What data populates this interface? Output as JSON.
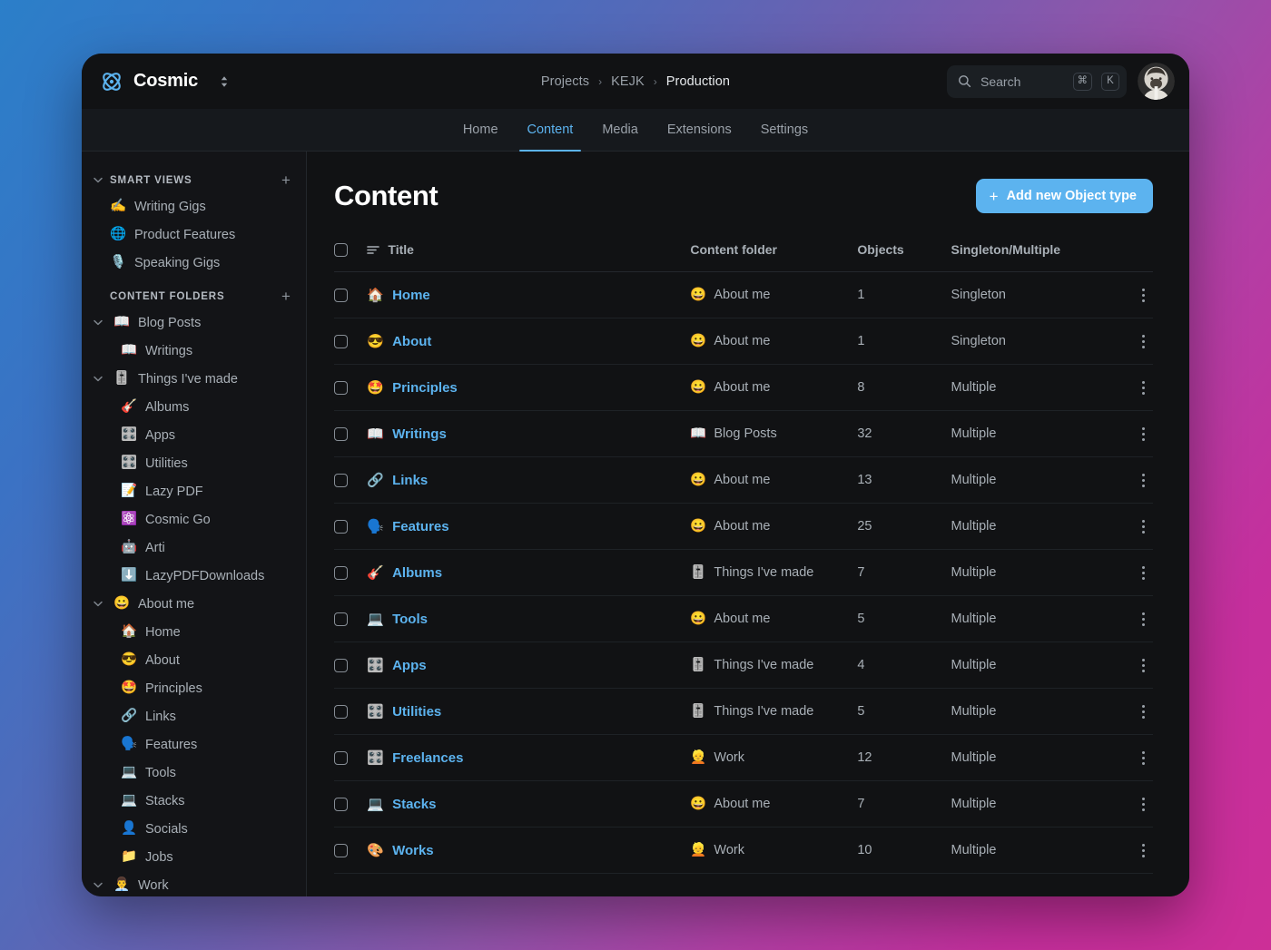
{
  "window": {
    "brand_name": "Cosmic",
    "brand_logo_icon": "cosmic-atom-logo",
    "project_switcher_icon": "chevron-up-down-icon"
  },
  "breadcrumb": {
    "separator": "›",
    "items": [
      {
        "label": "Projects",
        "active": false
      },
      {
        "label": "KEJK",
        "active": false
      },
      {
        "label": "Production",
        "active": true
      }
    ]
  },
  "search": {
    "icon": "search-icon",
    "placeholder": "Search",
    "value": "",
    "shortcut_modifier": "⌘",
    "shortcut_key": "K"
  },
  "avatar": {
    "icon": "user-avatar",
    "alt": "User avatar"
  },
  "nav_tabs": [
    {
      "label": "Home",
      "active": false
    },
    {
      "label": "Content",
      "active": true
    },
    {
      "label": "Media",
      "active": false
    },
    {
      "label": "Extensions",
      "active": false
    },
    {
      "label": "Settings",
      "active": false
    }
  ],
  "sidebar": {
    "smart_views": {
      "title": "SMART VIEWS",
      "add_label": "+",
      "chevron_icon": "chevron-down-icon",
      "items": [
        {
          "label": "Writing Gigs",
          "emoji": "✍️"
        },
        {
          "label": "Product Features",
          "emoji": "🌐"
        },
        {
          "label": "Speaking Gigs",
          "emoji": "🎙️"
        }
      ]
    },
    "content_folders": {
      "title": "CONTENT FOLDERS",
      "add_label": "+",
      "groups": [
        {
          "label": "Blog Posts",
          "emoji": "📖",
          "expanded": true,
          "children": [
            {
              "label": "Writings",
              "emoji": "📖"
            }
          ]
        },
        {
          "label": "Things I've made",
          "emoji": "🎚️",
          "expanded": true,
          "children": [
            {
              "label": "Albums",
              "emoji": "🎸"
            },
            {
              "label": "Apps",
              "emoji": "🎛️"
            },
            {
              "label": "Utilities",
              "emoji": "🎛️"
            },
            {
              "label": "Lazy PDF",
              "emoji": "📝"
            },
            {
              "label": "Cosmic Go",
              "emoji": "⚛️"
            },
            {
              "label": "Arti",
              "emoji": "🤖"
            },
            {
              "label": "LazyPDFDownloads",
              "emoji": "⬇️"
            }
          ]
        },
        {
          "label": "About me",
          "emoji": "😀",
          "expanded": true,
          "children": [
            {
              "label": "Home",
              "emoji": "🏠"
            },
            {
              "label": "About",
              "emoji": "😎"
            },
            {
              "label": "Principles",
              "emoji": "🤩"
            },
            {
              "label": "Links",
              "emoji": "🔗"
            },
            {
              "label": "Features",
              "emoji": "🗣️"
            },
            {
              "label": "Tools",
              "emoji": "💻"
            },
            {
              "label": "Stacks",
              "emoji": "💻"
            },
            {
              "label": "Socials",
              "emoji": "👤"
            },
            {
              "label": "Jobs",
              "emoji": "📁"
            }
          ]
        },
        {
          "label": "Work",
          "emoji": "👨‍💼",
          "expanded": true,
          "children": []
        }
      ]
    }
  },
  "main": {
    "page_title": "Content",
    "add_button": {
      "label": "Add new Object type",
      "icon": "plus-icon"
    },
    "table": {
      "headers": {
        "select_all_icon": "checkbox-icon",
        "sort_icon": "sort-lines-icon",
        "title": "Title",
        "folder": "Content folder",
        "objects": "Objects",
        "type": "Singleton/Multiple"
      },
      "rows": [
        {
          "emoji": "🏠",
          "title": "Home",
          "folder_emoji": "😀",
          "folder": "About me",
          "objects": "1",
          "type": "Singleton"
        },
        {
          "emoji": "😎",
          "title": "About",
          "folder_emoji": "😀",
          "folder": "About me",
          "objects": "1",
          "type": "Singleton"
        },
        {
          "emoji": "🤩",
          "title": "Principles",
          "folder_emoji": "😀",
          "folder": "About me",
          "objects": "8",
          "type": "Multiple"
        },
        {
          "emoji": "📖",
          "title": "Writings",
          "folder_emoji": "📖",
          "folder": "Blog Posts",
          "objects": "32",
          "type": "Multiple"
        },
        {
          "emoji": "🔗",
          "title": "Links",
          "folder_emoji": "😀",
          "folder": "About me",
          "objects": "13",
          "type": "Multiple"
        },
        {
          "emoji": "🗣️",
          "title": "Features",
          "folder_emoji": "😀",
          "folder": "About me",
          "objects": "25",
          "type": "Multiple"
        },
        {
          "emoji": "🎸",
          "title": "Albums",
          "folder_emoji": "🎚️",
          "folder": "Things I've made",
          "objects": "7",
          "type": "Multiple"
        },
        {
          "emoji": "💻",
          "title": "Tools",
          "folder_emoji": "😀",
          "folder": "About me",
          "objects": "5",
          "type": "Multiple"
        },
        {
          "emoji": "🎛️",
          "title": "Apps",
          "folder_emoji": "🎚️",
          "folder": "Things I've made",
          "objects": "4",
          "type": "Multiple"
        },
        {
          "emoji": "🎛️",
          "title": "Utilities",
          "folder_emoji": "🎚️",
          "folder": "Things I've made",
          "objects": "5",
          "type": "Multiple"
        },
        {
          "emoji": "🎛️",
          "title": "Freelances",
          "folder_emoji": "👱",
          "folder": "Work",
          "objects": "12",
          "type": "Multiple"
        },
        {
          "emoji": "💻",
          "title": "Stacks",
          "folder_emoji": "😀",
          "folder": "About me",
          "objects": "7",
          "type": "Multiple"
        },
        {
          "emoji": "🎨",
          "title": "Works",
          "folder_emoji": "👱",
          "folder": "Work",
          "objects": "10",
          "type": "Multiple"
        }
      ]
    }
  },
  "colors": {
    "accent": "#5cb3ef",
    "window_bg": "#111214",
    "sidebar_bg": "#131417",
    "navbar_bg": "#16191d",
    "text_primary": "#ffffff",
    "text_secondary": "#a9b0b7",
    "gradient_start": "#2b7fc9",
    "gradient_end": "#cc2f97"
  }
}
